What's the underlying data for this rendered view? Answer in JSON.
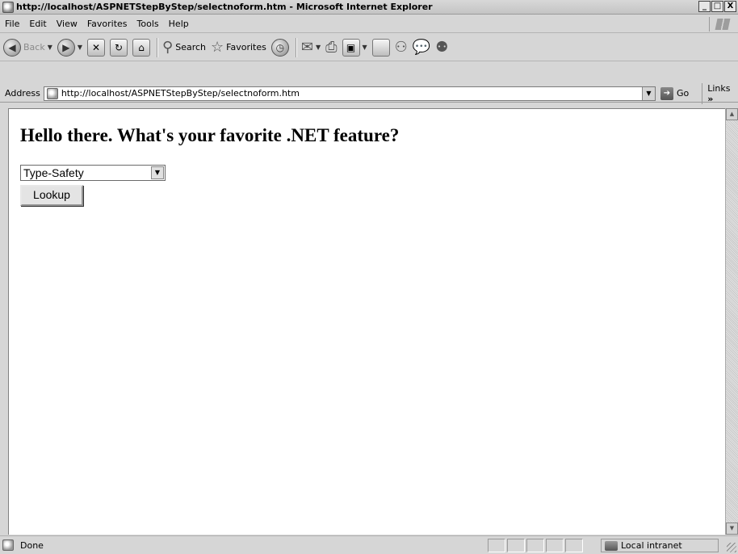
{
  "window": {
    "title": "http://localhost/ASPNETStepByStep/selectnoform.htm - Microsoft Internet Explorer",
    "minimize": "_",
    "maximize": "□",
    "close": "X"
  },
  "menu": {
    "items": [
      {
        "label": "File",
        "icon": "none"
      },
      {
        "label": "Edit"
      },
      {
        "label": "View"
      },
      {
        "label": "Favorites"
      },
      {
        "label": "Tools"
      },
      {
        "label": "Help"
      }
    ]
  },
  "toolbar": {
    "back_label": "Back",
    "search_label": "Search",
    "favorites_label": "Favorites"
  },
  "address": {
    "label": "Address",
    "url": "http://localhost/ASPNETStepByStep/selectnoform.htm",
    "go_label": "Go",
    "links_label": "Links",
    "links_chevron": "»"
  },
  "page": {
    "heading": "Hello there. What's your favorite .NET feature?",
    "select_value": "Type-Safety",
    "button_label": "Lookup"
  },
  "status": {
    "text": "Done",
    "zone": "Local intranet"
  }
}
